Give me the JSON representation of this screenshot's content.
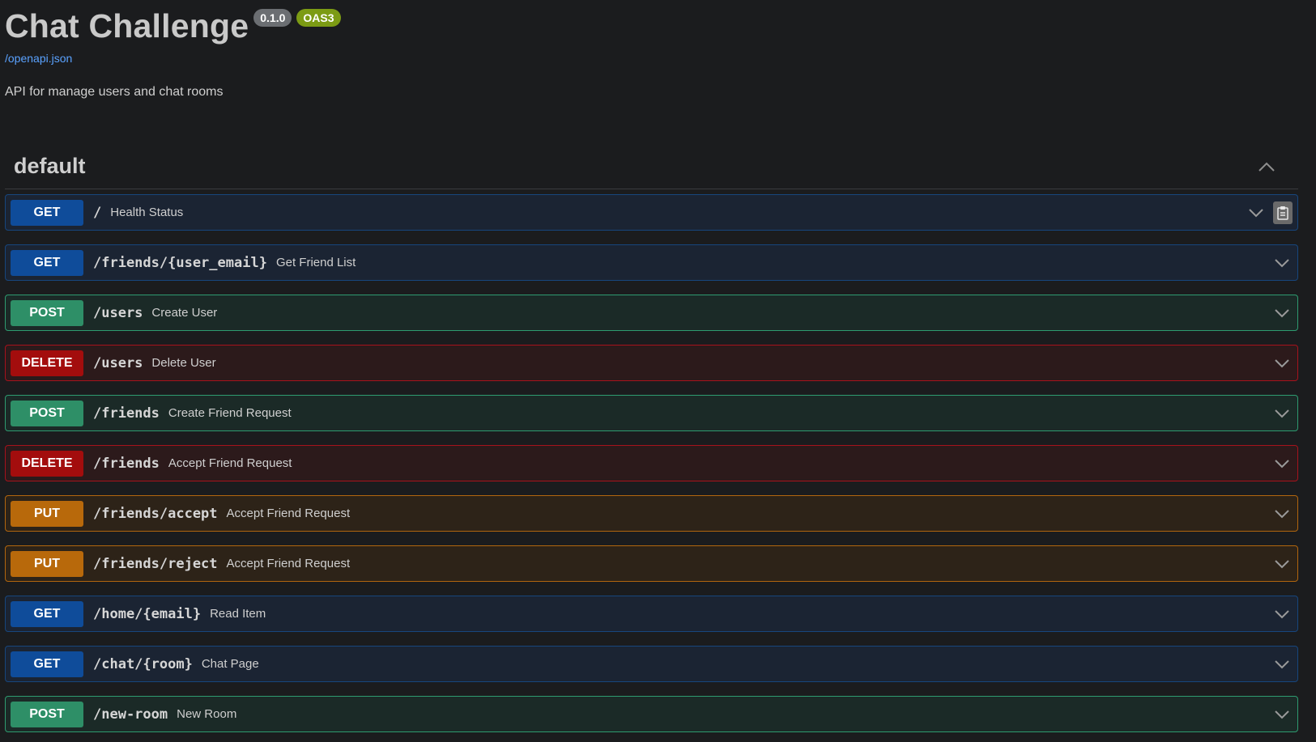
{
  "info": {
    "title": "Chat Challenge",
    "version": "0.1.0",
    "oas": "OAS3",
    "spec_link": "/openapi.json",
    "description": "API for manage users and chat rooms"
  },
  "tag": {
    "name": "default"
  },
  "colors": {
    "get": "#0f4c9a",
    "post": "#2e8f67",
    "delete": "#a30d0d",
    "put": "#b8690b",
    "link": "#5aa2ff"
  },
  "operations": [
    {
      "method": "GET",
      "path": "/",
      "summary": "Health Status"
    },
    {
      "method": "GET",
      "path": "/friends/{user_email}",
      "summary": "Get Friend List"
    },
    {
      "method": "POST",
      "path": "/users",
      "summary": "Create User"
    },
    {
      "method": "DELETE",
      "path": "/users",
      "summary": "Delete User"
    },
    {
      "method": "POST",
      "path": "/friends",
      "summary": "Create Friend Request"
    },
    {
      "method": "DELETE",
      "path": "/friends",
      "summary": "Accept Friend Request"
    },
    {
      "method": "PUT",
      "path": "/friends/accept",
      "summary": "Accept Friend Request"
    },
    {
      "method": "PUT",
      "path": "/friends/reject",
      "summary": "Accept Friend Request"
    },
    {
      "method": "GET",
      "path": "/home/{email}",
      "summary": "Read Item"
    },
    {
      "method": "GET",
      "path": "/chat/{room}",
      "summary": "Chat Page"
    },
    {
      "method": "POST",
      "path": "/new-room",
      "summary": "New Room"
    }
  ]
}
